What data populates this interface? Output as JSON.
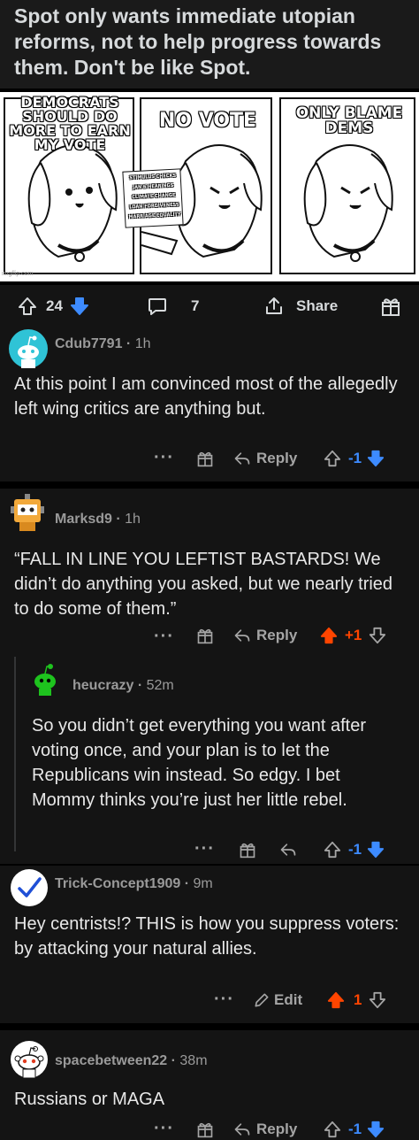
{
  "post": {
    "title": "Spot only wants immediate utopian reforms, not to help progress towards them. Don't be like Spot.",
    "meme": {
      "panel1_caption": "DEMOCRATS SHOULD DO MORE TO EARN MY VOTE",
      "panel2_caption": "NO VOTE",
      "panel3_caption": "ONLY BLAME DEMS",
      "sign_lines": [
        "STIMULUS CHECKS",
        "JAN 6 HEARINGS",
        "CLIMATE CHANGE",
        "LOAN FORGIVENESS",
        "MARRIAGE EQUALITY"
      ],
      "watermark": "imgflip.com"
    },
    "votes": "24",
    "comments_count": "7",
    "share_label": "Share"
  },
  "comments": [
    {
      "username": "Cdub7791",
      "time": "1h",
      "body": "At this point I am convinced most of the allegedly left wing critics are anything but.",
      "score": "-1",
      "reply_label": "Reply",
      "avatar_color": "#2fc3d6"
    },
    {
      "username": "Marksd9",
      "time": "1h",
      "body": "“FALL IN LINE YOU LEFTIST BASTARDS! We didn’t do anything you asked, but we nearly tried to do some of them.”",
      "score": "+1",
      "reply_label": "Reply",
      "avatar_color": "#f2a93b"
    },
    {
      "username": "heucrazy",
      "time": "52m",
      "body": "So you didn’t get everything you want after voting once, and your plan is to let the Republicans win instead. So edgy. I bet Mommy thinks you’re just her little rebel.",
      "score": "-1",
      "avatar_color": "#1ec31e"
    },
    {
      "username": "Trick-Concept1909",
      "time": "9m",
      "body": "Hey centrists!?  THIS is how you suppress voters: by attacking your natural allies.",
      "score": "1",
      "edit_label": "Edit",
      "avatar_color": "#ffffff"
    },
    {
      "username": "spacebetween22",
      "time": "38m",
      "body": "Russians or MAGA",
      "score": "-1",
      "reply_label": "Reply",
      "avatar_color": "#ffffff"
    }
  ],
  "colors": {
    "upvote": "#ff4500",
    "downvote": "#3d8bff",
    "background": "#000000",
    "panel": "#141414"
  },
  "icons": [
    "upvote-icon",
    "downvote-icon",
    "comment-icon",
    "share-icon",
    "award-icon",
    "reply-icon",
    "edit-icon",
    "more-icon"
  ]
}
